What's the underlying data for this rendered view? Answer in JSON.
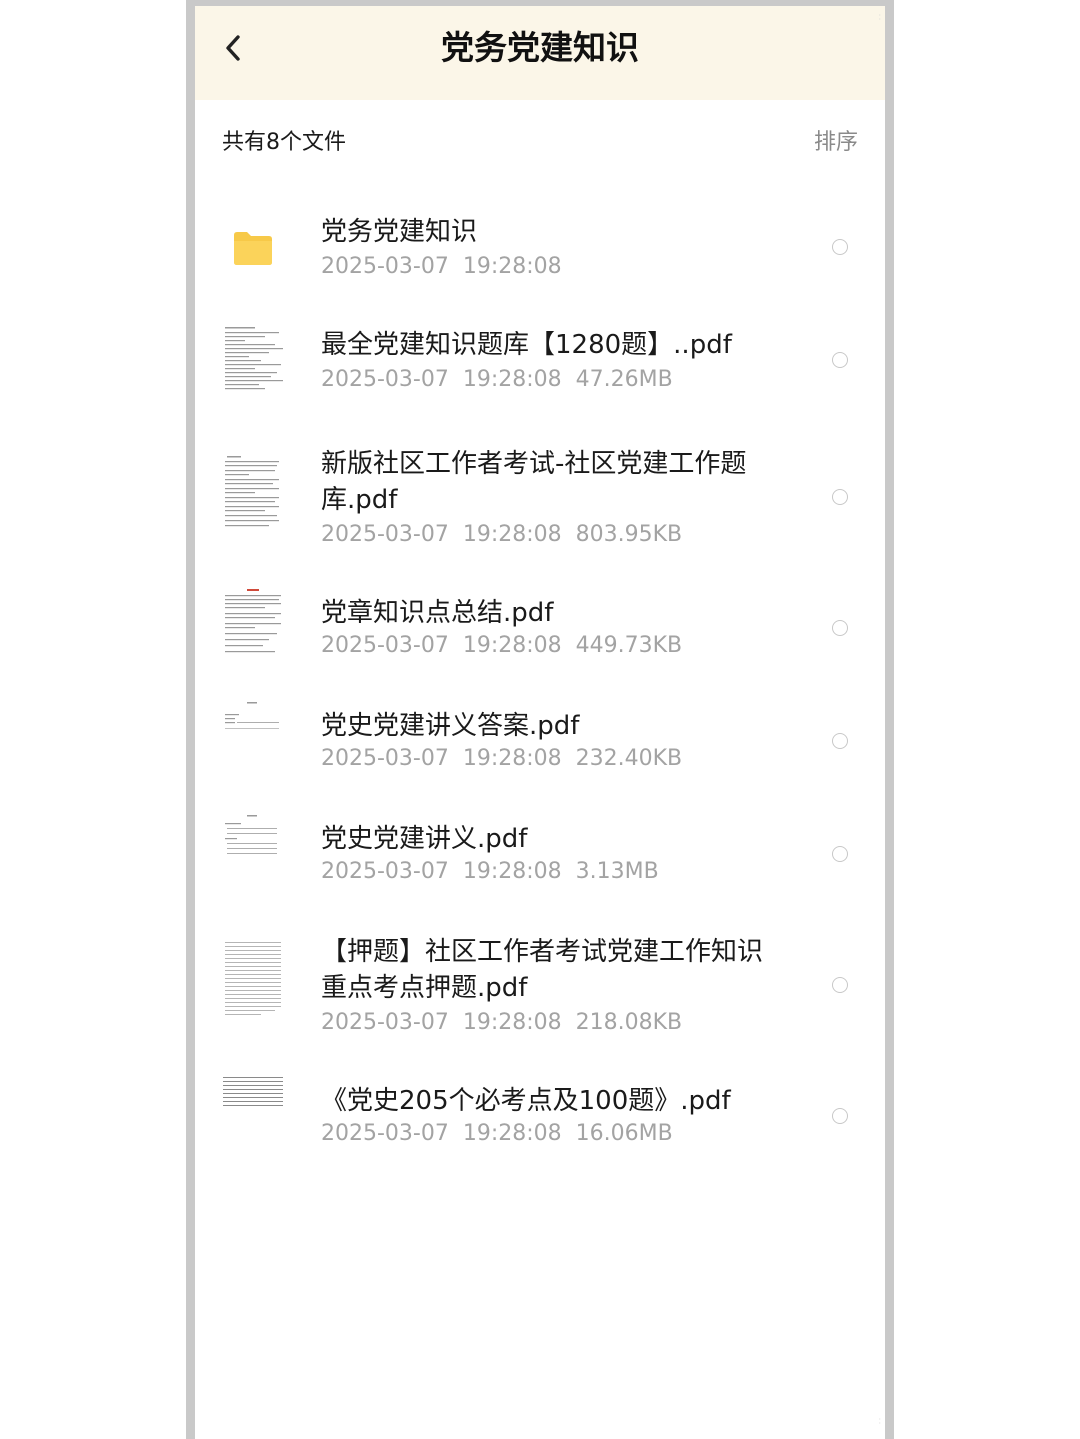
{
  "header": {
    "title": "党务党建知识",
    "back_icon": "chevron-left-icon"
  },
  "toolbar": {
    "count_label": "共有8个文件",
    "sort_label": "排序"
  },
  "colors": {
    "header_bg": "#fbf6e8",
    "folder": "#f7c948",
    "meta_text": "#a3a3a3"
  },
  "files": [
    {
      "name": "党务党建知识",
      "meta": "2025-03-07  19:28:08",
      "type": "folder",
      "icon": "folder-icon"
    },
    {
      "name": "最全党建知识题库【1280题】..pdf",
      "meta": "2025-03-07  19:28:08  47.26MB",
      "type": "pdf",
      "icon": "pdf-thumbnail"
    },
    {
      "name": "新版社区工作者考试-社区党建工作题库.pdf",
      "meta": "2025-03-07  19:28:08  803.95KB",
      "type": "pdf",
      "icon": "pdf-thumbnail"
    },
    {
      "name": "党章知识点总结.pdf",
      "meta": "2025-03-07  19:28:08  449.73KB",
      "type": "pdf",
      "icon": "pdf-thumbnail"
    },
    {
      "name": "党史党建讲义答案.pdf",
      "meta": "2025-03-07  19:28:08  232.40KB",
      "type": "pdf",
      "icon": "pdf-thumbnail"
    },
    {
      "name": "党史党建讲义.pdf",
      "meta": "2025-03-07  19:28:08  3.13MB",
      "type": "pdf",
      "icon": "pdf-thumbnail"
    },
    {
      "name": "【押题】社区工作者考试党建工作知识重点考点押题.pdf",
      "meta": "2025-03-07  19:28:08  218.08KB",
      "type": "pdf",
      "icon": "pdf-thumbnail"
    },
    {
      "name": "《党史205个必考点及100题》.pdf",
      "meta": "2025-03-07  19:28:08  16.06MB",
      "type": "pdf",
      "icon": "pdf-thumbnail"
    }
  ]
}
